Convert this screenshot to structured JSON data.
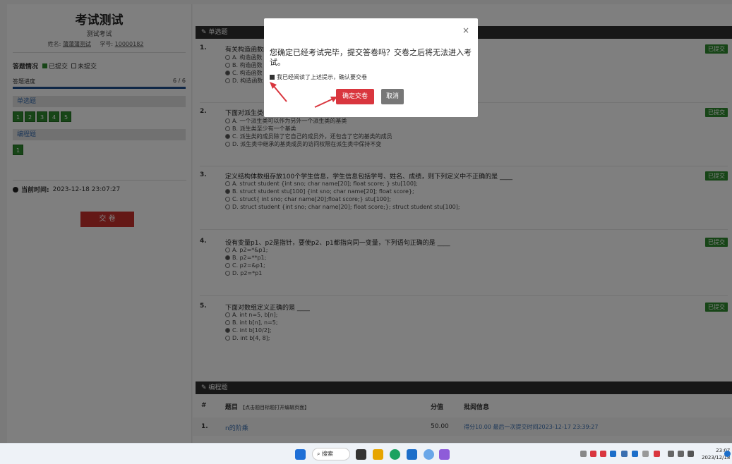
{
  "left": {
    "exam_title": "考试测试",
    "exam_subtitle": "测试考试",
    "name_label": "姓名:",
    "name_value": "蒲蒲蒲测试",
    "id_label": "学号:",
    "id_value": "10000182",
    "answer_status_label": "答题情况",
    "legend_submitted": "已提交",
    "legend_unsubmitted": "未提交",
    "progress_label": "答题进度",
    "progress_value": "6 / 6",
    "progress_fraction": 1.0,
    "section_single": "单选题",
    "single_numbers": [
      "1",
      "2",
      "3",
      "4",
      "5"
    ],
    "section_programming": "编程题",
    "programming_numbers": [
      "1"
    ],
    "current_time_label": "当前时间:",
    "current_time_value": "2023-12-18 23:07:27",
    "submit_button": "交 卷"
  },
  "main": {
    "single_header": "单选题",
    "submitted_badge": "已提交",
    "questions": [
      {
        "num": "1.",
        "stem": "有关构造函数的说法，正确的是",
        "options": [
          "A. 构造函数",
          "B. 构造函数",
          "C. 构造函数",
          "D. 构造函数"
        ],
        "selected": 2
      },
      {
        "num": "2.",
        "stem": "下面对派生类的描述中，错误的是",
        "options": [
          "A. 一个派生类可以作为另外一个派生类的基类",
          "B. 派生类至少有一个基类",
          "C. 派生类的成员除了它自己的成员外，还包含了它的基类的成员",
          "D. 派生类中继承的基类成员的访问权限在派生类中保持不变"
        ],
        "selected": 2
      },
      {
        "num": "3.",
        "stem": "定义结构体数组存放100个学生信息，学生信息包括学号、姓名、成绩，则下列定义中不正确的是 ____",
        "options": [
          "A. struct student {int sno; char name[20]; float score; } stu[100];",
          "B. struct student stu[100] {int sno; char name[20]; float score};",
          "C. struct{ int sno; char name[20];float score;} stu[100];",
          "D. struct student {int sno; char name[20]; float score;}; struct student stu[100];"
        ],
        "selected": 1
      },
      {
        "num": "4.",
        "stem": "设有变量p1、p2是指针，要使p2、p1都指向同一变量，下列语句正确的是 ____",
        "options": [
          "A. p2=*&p1;",
          "B. p2=**p1;",
          "C. p2=&p1;",
          "D. p2=*p1"
        ],
        "selected": 1
      },
      {
        "num": "5.",
        "stem": "下面对数组定义正确的是 ____",
        "options": [
          "A. int n=5, b[n];",
          "B. int b[n], n=5;",
          "C. int b[10/2];",
          "D. int b[4, 8];"
        ],
        "selected": 2
      }
    ],
    "programming_header": "编程题",
    "table_headers": {
      "index": "#",
      "title": "题目",
      "title_note": "【点击题目标题打开编辑页面】",
      "score": "分值",
      "review": "批阅信息"
    },
    "table_rows": [
      {
        "index": "1.",
        "title": "n的阶乘",
        "score": "50.00",
        "review": "得分10.00   最后一次提交时间2023-12-17 23:39:27"
      }
    ]
  },
  "modal": {
    "close": "×",
    "message": "您确定已经考试完毕，提交答卷吗？交卷之后将无法进入考试。",
    "checkbox_label": "我已经阅读了上述提示，确认要交卷",
    "confirm_button": "确定交卷",
    "cancel_button": "取消"
  },
  "taskbar": {
    "search_label": "搜索",
    "clock_time": "23:07",
    "clock_date": "2023/12/18"
  }
}
